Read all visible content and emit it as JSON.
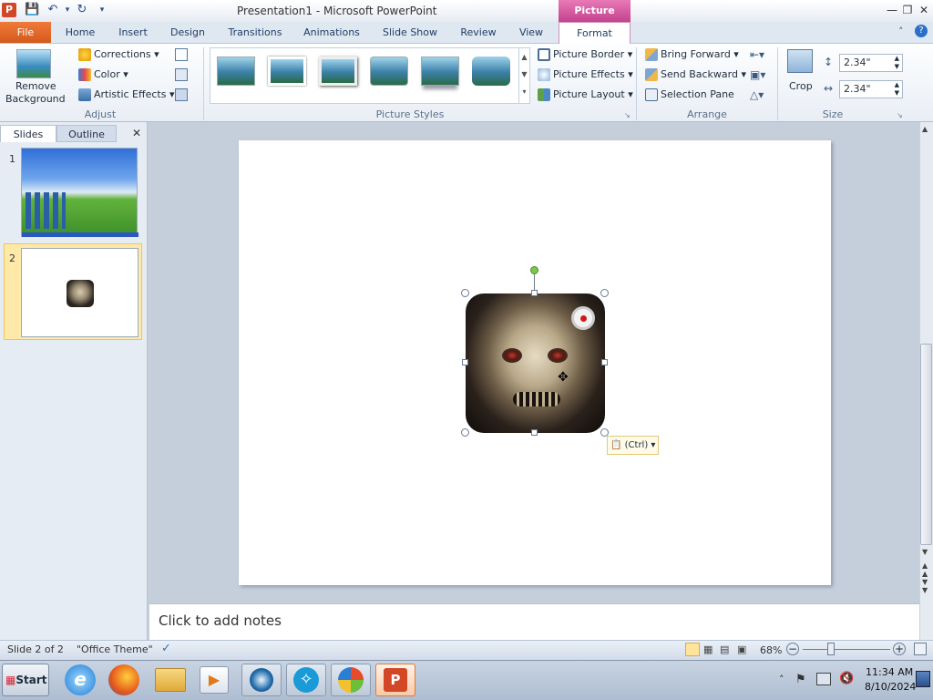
{
  "window": {
    "title": "Presentation1 - Microsoft PowerPoint",
    "contextual_tab_group": "Picture Tools"
  },
  "qat": {
    "app_icon": "P"
  },
  "tabs": {
    "file": "File",
    "home": "Home",
    "insert": "Insert",
    "design": "Design",
    "transitions": "Transitions",
    "animations": "Animations",
    "slide_show": "Slide Show",
    "review": "Review",
    "view": "View",
    "format": "Format"
  },
  "ribbon": {
    "adjust": {
      "label": "Adjust",
      "remove_background_1": "Remove",
      "remove_background_2": "Background",
      "corrections": "Corrections",
      "color": "Color",
      "artistic_effects": "Artistic Effects"
    },
    "picture_styles": {
      "label": "Picture Styles",
      "picture_border": "Picture Border",
      "picture_effects": "Picture Effects",
      "picture_layout": "Picture Layout"
    },
    "arrange": {
      "label": "Arrange",
      "bring_forward": "Bring Forward",
      "send_backward": "Send Backward",
      "selection_pane": "Selection Pane"
    },
    "size": {
      "label": "Size",
      "crop": "Crop",
      "height": "2.34\"",
      "width": "2.34\""
    }
  },
  "left_pane": {
    "tab_slides": "Slides",
    "tab_outline": "Outline",
    "slide1_num": "1",
    "slide2_num": "2"
  },
  "paste_options": {
    "label": "(Ctrl)"
  },
  "notes": {
    "placeholder": "Click to add notes"
  },
  "status": {
    "slide": "Slide 2 of 2",
    "theme": "\"Office Theme\"",
    "zoom": "68%"
  },
  "taskbar": {
    "start": "Start",
    "time": "11:34 AM",
    "date": "8/10/2024"
  }
}
